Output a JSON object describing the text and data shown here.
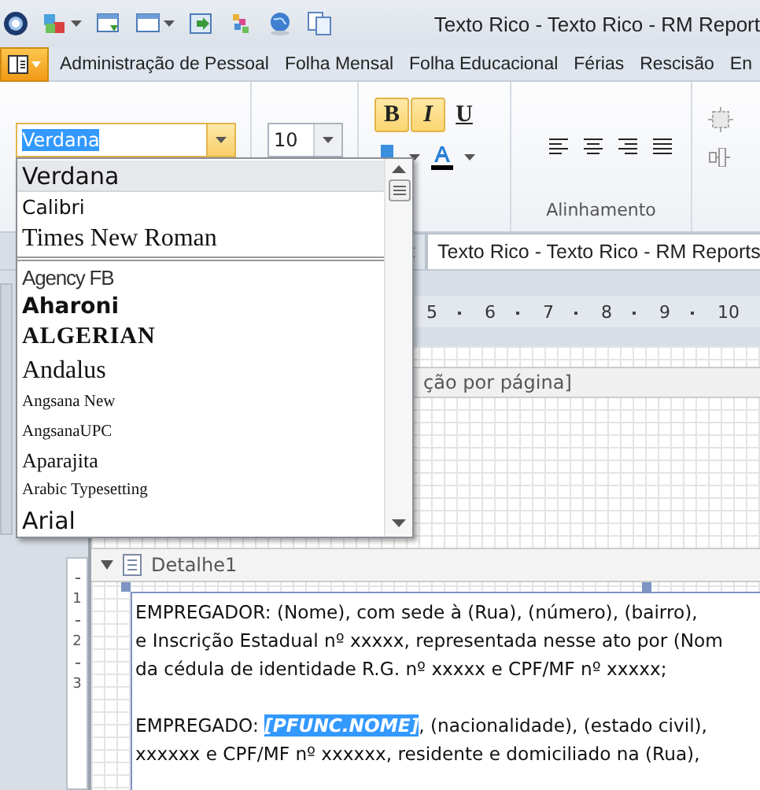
{
  "title_bar": {
    "title": "Texto Rico - Texto Rico - RM Report"
  },
  "menu_bar": {
    "items": [
      "Administração de Pessoal",
      "Folha Mensal",
      "Folha Educacional",
      "Férias",
      "Rescisão",
      "En"
    ]
  },
  "ribbon": {
    "font": {
      "value": "Verdana",
      "expanded": true
    },
    "size": {
      "value": "10"
    },
    "format_buttons": [
      {
        "label": "B",
        "kind": "bold",
        "selected": true
      },
      {
        "label": "I",
        "kind": "italic",
        "selected": true
      },
      {
        "label": "U",
        "kind": "underline",
        "selected": false
      }
    ],
    "alignment_group": {
      "label": "Alinhamento"
    }
  },
  "font_dropdown": {
    "recent_fonts": [
      {
        "name": "Verdana",
        "kind": "sans-large",
        "selected": true
      },
      {
        "name": "Calibri",
        "kind": "sans",
        "selected": false
      },
      {
        "name": "Times New Roman",
        "kind": "serif",
        "selected": false
      }
    ],
    "all_fonts": [
      {
        "name": "Agency FB",
        "kind": "condensed",
        "selected": false
      },
      {
        "name": "Aharoni",
        "kind": "heavy",
        "selected": false
      },
      {
        "name": "ALGERIAN",
        "kind": "display",
        "selected": false
      },
      {
        "name": "Andalus",
        "kind": "serif",
        "selected": false
      },
      {
        "name": "Angsana New",
        "kind": "small-serif",
        "selected": false
      },
      {
        "name": "AngsanaUPC",
        "kind": "small-serif",
        "selected": false
      },
      {
        "name": "Aparajita",
        "kind": "medium-serif",
        "selected": false
      },
      {
        "name": "Arabic Typesetting",
        "kind": "small-serif",
        "selected": false
      },
      {
        "name": "Arial",
        "kind": "sans-large",
        "selected": false
      }
    ]
  },
  "document": {
    "tabs": [
      {
        "selected": false
      },
      {
        "label": "Texto Rico - Texto Rico - RM Reports",
        "selected": true
      }
    ],
    "ruler": [
      "5",
      "6",
      "7",
      "8",
      "9",
      "10"
    ],
    "vertical_ruler": [
      "1",
      "2",
      "3"
    ],
    "page_band": {
      "label": "ção por página]"
    },
    "detail_band": {
      "label": "Detalhe1"
    },
    "lines": [
      {
        "text": "EMPREGADOR: (Nome), com sede à (Rua), (número), (bairro),"
      },
      {
        "text": "e Inscrição Estadual nº xxxxx, representada nesse ato por (Nom"
      },
      {
        "text": "da cédula de identidade R.G. nº xxxxx e CPF/MF nº xxxxx;"
      },
      {
        "text": "EMPREGADO: ",
        "field": "[PFUNC.NOME]",
        "after": ", (nacionalidade), (estado civil),"
      },
      {
        "text": "xxxxxx e CPF/MF nº xxxxxx, residente e domiciliado na (Rua),"
      }
    ]
  }
}
